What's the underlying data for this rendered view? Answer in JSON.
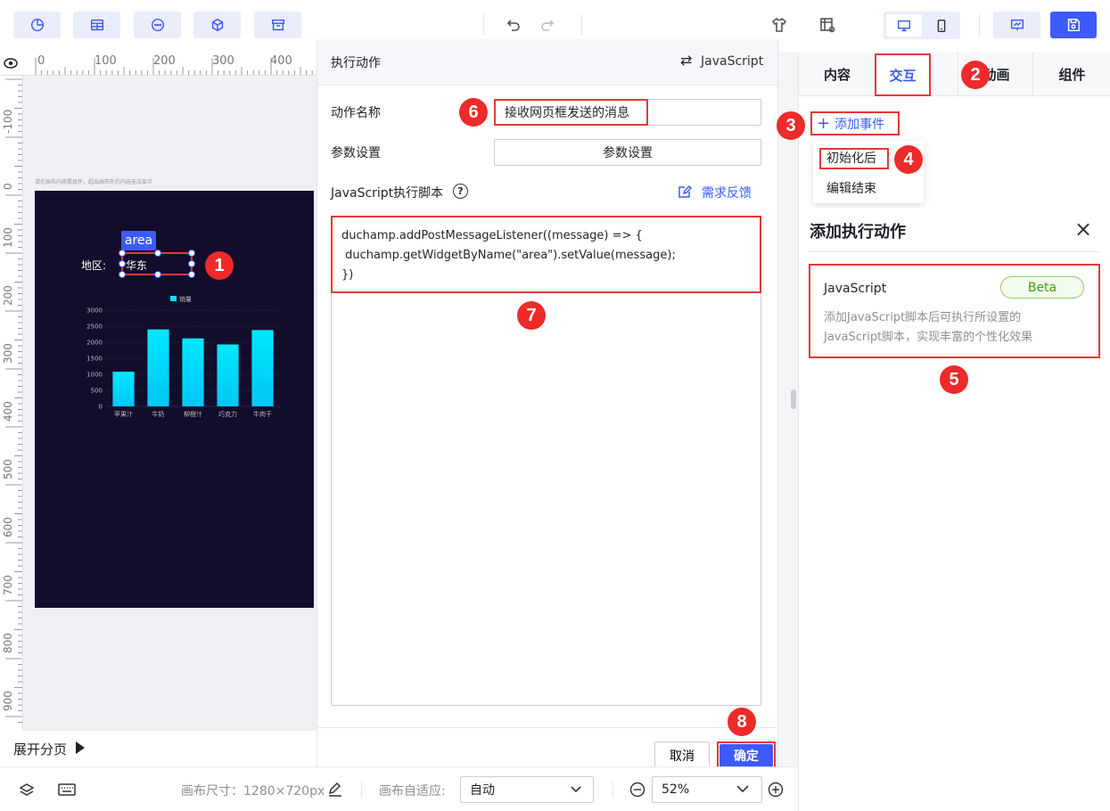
{
  "toolbar": {
    "left_icons": [
      "chart-icon",
      "table-icon",
      "more-icon",
      "cube-icon",
      "archive-icon"
    ],
    "center_icons": [
      "undo-icon",
      "redo-icon"
    ],
    "right_icons": [
      "theme-icon",
      "grid-settings-icon",
      "desktop-icon",
      "mobile-icon",
      "preview-icon",
      "save-icon"
    ]
  },
  "ruler": {
    "top": [
      "0",
      "100",
      "200",
      "300",
      "400"
    ],
    "left": [
      "-100",
      "0",
      "100",
      "200",
      "300",
      "400",
      "500",
      "600",
      "700",
      "800",
      "900"
    ]
  },
  "canvas": {
    "hint": "请在画布内放置组件，超出画布外的内容无法显示",
    "widget_tag": "area",
    "region_label": "地区:",
    "region_value": "华东",
    "chart_legend": "销量"
  },
  "chart_data": {
    "type": "bar",
    "categories": [
      "苹果汁",
      "牛奶",
      "柳橙汁",
      "巧克力",
      "牛肉干"
    ],
    "series": [
      {
        "name": "销量",
        "values": [
          1080,
          2400,
          2120,
          1930,
          2380
        ]
      }
    ],
    "yticks": [
      "3000",
      "2500",
      "2000",
      "1500",
      "1000",
      "500",
      "0"
    ],
    "ylim": [
      0,
      3000
    ],
    "color": "#00e5ff"
  },
  "expand_pages": "展开分页",
  "exec_panel": {
    "title": "执行动作",
    "switch_label": "JavaScript",
    "action_name_label": "动作名称",
    "action_name_value": "接收网页框发送的消息",
    "param_label": "参数设置",
    "param_button": "参数设置",
    "script_label": "JavaScript执行脚本",
    "feedback": "需求反馈",
    "code_lines": [
      "duchamp.addPostMessageListener((message) => {",
      " duchamp.getWidgetByName(\"area\").setValue(message);",
      "})"
    ],
    "cancel": "取消",
    "confirm": "确定"
  },
  "right_panel": {
    "tabs": [
      "内容",
      "交互",
      "动画",
      "组件"
    ],
    "active_tab": "交互",
    "add_event": "添加事件",
    "menu_items": [
      "初始化后",
      "编辑结束"
    ],
    "add_action_title": "添加执行动作",
    "js_card": {
      "title": "JavaScript",
      "badge": "Beta",
      "desc_line1": "添加JavaScript脚本后可执行所设置的",
      "desc_line2": "JavaScript脚本，实现丰富的个性化效果"
    }
  },
  "bottom_bar": {
    "canvas_size": "画布尺寸：1280×720px",
    "adapt_label": "画布自适应:",
    "adapt_value": "自动",
    "zoom_value": "52%"
  },
  "markers": [
    "1",
    "2",
    "3",
    "4",
    "5",
    "6",
    "7",
    "8"
  ]
}
